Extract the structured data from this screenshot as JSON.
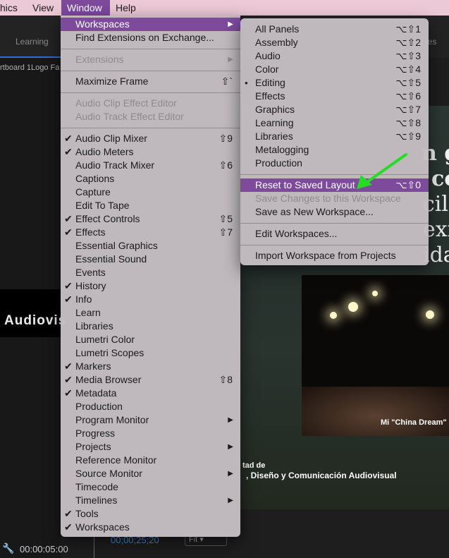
{
  "menubar": {
    "items": [
      {
        "label": "hics"
      },
      {
        "label": "View"
      },
      {
        "label": "Window"
      },
      {
        "label": "Help"
      }
    ]
  },
  "background": {
    "tab_learning": "Learning",
    "tab_right": "ies",
    "artboard": "rtboard 1Logo Fa",
    "audiovis": "Audiovis",
    "timecode": "00:00:05:00",
    "timecode2": "00;00;25;20",
    "fit": "Fit",
    "caption": "Mi \"China Dream\"",
    "big_lines": [
      "n g",
      "co",
      "cil",
      "exi",
      "ida"
    ],
    "fac_line1": "tad de",
    "fac_line2": ", Diseño y Comunicación Audiovisual"
  },
  "window_menu": {
    "items": [
      {
        "label": "Workspaces",
        "highlight": true,
        "submenu": true
      },
      {
        "label": "Find Extensions on Exchange..."
      },
      {
        "sep": true
      },
      {
        "label": "Extensions",
        "disabled": true,
        "submenu": true
      },
      {
        "sep": true
      },
      {
        "label": "Maximize Frame",
        "shortcut": "⇧`"
      },
      {
        "sep": true
      },
      {
        "label": "Audio Clip Effect Editor",
        "disabled": true
      },
      {
        "label": "Audio Track Effect Editor",
        "disabled": true
      },
      {
        "sep": true
      },
      {
        "label": "Audio Clip Mixer",
        "checked": true,
        "shortcut": "⇧9"
      },
      {
        "label": "Audio Meters",
        "checked": true
      },
      {
        "label": "Audio Track Mixer",
        "shortcut": "⇧6"
      },
      {
        "label": "Captions"
      },
      {
        "label": "Capture"
      },
      {
        "label": "Edit To Tape"
      },
      {
        "label": "Effect Controls",
        "checked": true,
        "shortcut": "⇧5"
      },
      {
        "label": "Effects",
        "checked": true,
        "shortcut": "⇧7"
      },
      {
        "label": "Essential Graphics"
      },
      {
        "label": "Essential Sound"
      },
      {
        "label": "Events"
      },
      {
        "label": "History",
        "checked": true
      },
      {
        "label": "Info",
        "checked": true
      },
      {
        "label": "Learn"
      },
      {
        "label": "Libraries"
      },
      {
        "label": "Lumetri Color"
      },
      {
        "label": "Lumetri Scopes"
      },
      {
        "label": "Markers",
        "checked": true
      },
      {
        "label": "Media Browser",
        "checked": true,
        "shortcut": "⇧8"
      },
      {
        "label": "Metadata",
        "checked": true
      },
      {
        "label": "Production"
      },
      {
        "label": "Program Monitor",
        "submenu": true
      },
      {
        "label": "Progress"
      },
      {
        "label": "Projects",
        "submenu": true
      },
      {
        "label": "Reference Monitor"
      },
      {
        "label": "Source Monitor",
        "submenu": true
      },
      {
        "label": "Timecode"
      },
      {
        "label": "Timelines",
        "submenu": true
      },
      {
        "label": "Tools",
        "checked": true
      },
      {
        "label": "Workspaces",
        "checked": true
      }
    ]
  },
  "workspaces_menu": {
    "items": [
      {
        "label": "All Panels",
        "shortcut": "⌥⇧1"
      },
      {
        "label": "Assembly",
        "shortcut": "⌥⇧2"
      },
      {
        "label": "Audio",
        "shortcut": "⌥⇧3"
      },
      {
        "label": "Color",
        "shortcut": "⌥⇧4"
      },
      {
        "label": "Editing",
        "shortcut": "⌥⇧5",
        "bullet": true
      },
      {
        "label": "Effects",
        "shortcut": "⌥⇧6"
      },
      {
        "label": "Graphics",
        "shortcut": "⌥⇧7"
      },
      {
        "label": "Learning",
        "shortcut": "⌥⇧8"
      },
      {
        "label": "Libraries",
        "shortcut": "⌥⇧9"
      },
      {
        "label": "Metalogging"
      },
      {
        "label": "Production"
      },
      {
        "sep": true
      },
      {
        "label": "Reset to Saved Layout",
        "shortcut": "⌥⇧0",
        "highlight": true
      },
      {
        "label": "Save Changes to this Workspace",
        "disabled": true
      },
      {
        "label": "Save as New Workspace..."
      },
      {
        "sep": true
      },
      {
        "label": "Edit Workspaces..."
      },
      {
        "sep": true
      },
      {
        "label": "Import Workspace from Projects"
      }
    ]
  },
  "colors": {
    "menu_highlight": "#7d4a9c",
    "menubar_bg": "#ecc9d6",
    "annotation_arrow": "#22dd22"
  }
}
